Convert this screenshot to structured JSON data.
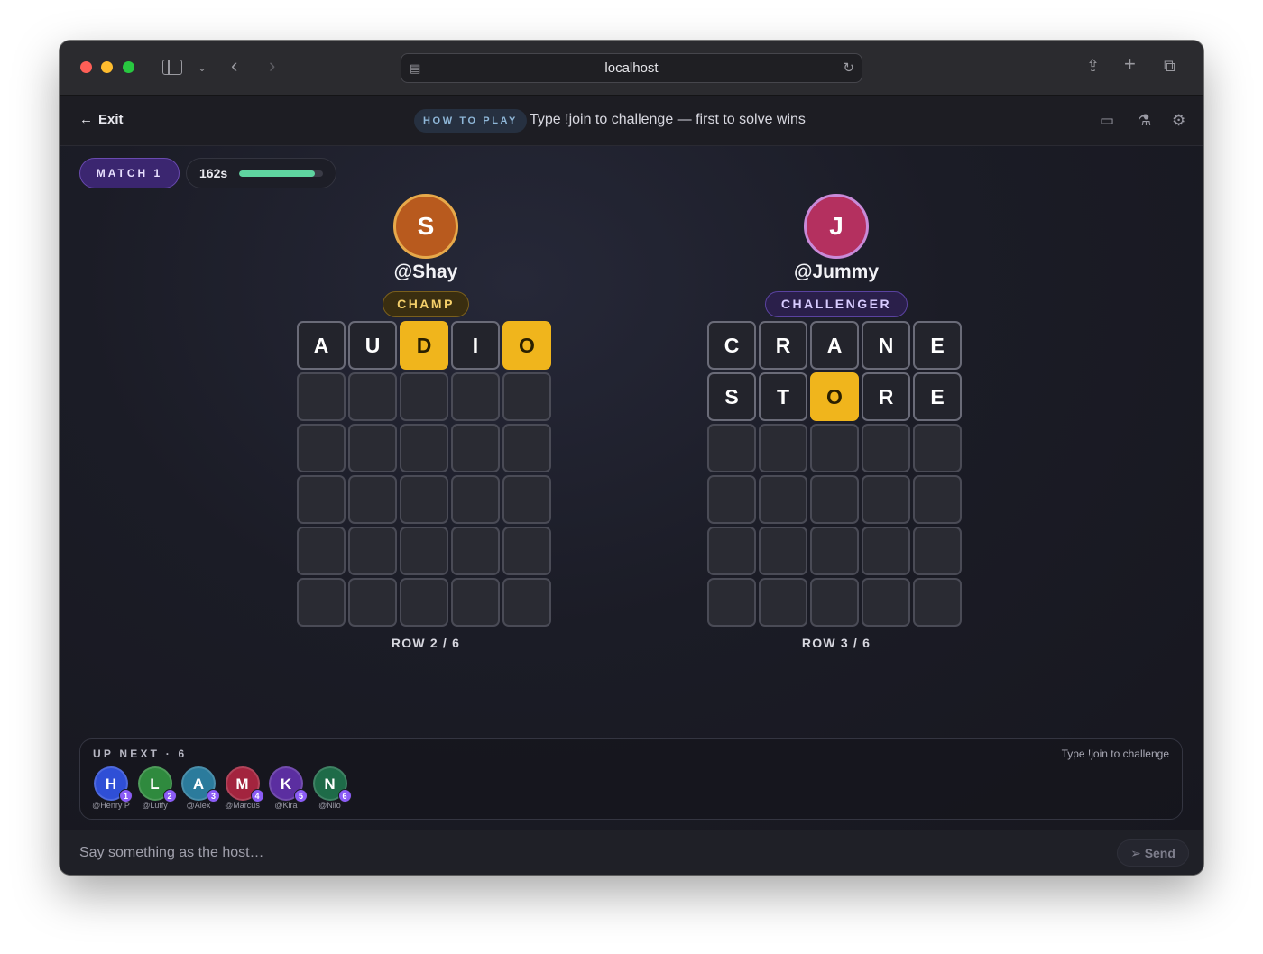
{
  "browser": {
    "url": "localhost"
  },
  "header": {
    "exit_label": "Exit",
    "howto_label": "HOW TO PLAY",
    "howto_text": "Type !join to challenge — first to solve wins"
  },
  "match": {
    "label": "MATCH 1",
    "timer": "162s",
    "timer_progress": 0.9
  },
  "players": [
    {
      "initial": "S",
      "handle": "@Shay",
      "role": "CHAMP",
      "avatar_color": "#b85a1e",
      "avatar_ring": "#e7a94a",
      "rows": [
        [
          "A",
          "U",
          "D",
          "I",
          "O"
        ],
        [
          "",
          "",
          "",
          "",
          ""
        ],
        [
          "",
          "",
          "",
          "",
          ""
        ],
        [
          "",
          "",
          "",
          "",
          ""
        ],
        [
          "",
          "",
          "",
          "",
          ""
        ],
        [
          "",
          "",
          "",
          "",
          ""
        ]
      ],
      "states": [
        [
          "absent",
          "absent",
          "present",
          "absent",
          "present"
        ],
        [],
        [],
        [],
        [],
        []
      ],
      "row_label": "ROW 2 / 6"
    },
    {
      "initial": "J",
      "handle": "@Jummy",
      "role": "CHALLENGER",
      "avatar_color": "#b4305f",
      "avatar_ring": "#c98ad8",
      "rows": [
        [
          "C",
          "R",
          "A",
          "N",
          "E"
        ],
        [
          "S",
          "T",
          "O",
          "R",
          "E"
        ],
        [
          "",
          "",
          "",
          "",
          ""
        ],
        [
          "",
          "",
          "",
          "",
          ""
        ],
        [
          "",
          "",
          "",
          "",
          ""
        ],
        [
          "",
          "",
          "",
          "",
          ""
        ]
      ],
      "states": [
        [
          "absent",
          "absent",
          "absent",
          "absent",
          "absent"
        ],
        [
          "absent",
          "absent",
          "present",
          "absent",
          "absent"
        ],
        [],
        [],
        [],
        []
      ],
      "row_label": "ROW 3 / 6"
    }
  ],
  "up_next": {
    "title": "UP NEXT · 6",
    "hint": "Type !join to challenge",
    "queue": [
      {
        "initial": "H",
        "name": "@Henry P",
        "position": "1",
        "color": "#2f4fd6"
      },
      {
        "initial": "L",
        "name": "@Luffy",
        "position": "2",
        "color": "#2f8a3e"
      },
      {
        "initial": "A",
        "name": "@Alex",
        "position": "3",
        "color": "#2b7b9c"
      },
      {
        "initial": "M",
        "name": "@Marcus",
        "position": "4",
        "color": "#a3243e"
      },
      {
        "initial": "K",
        "name": "@Kira",
        "position": "5",
        "color": "#5b2ea0"
      },
      {
        "initial": "N",
        "name": "@Nilo",
        "position": "6",
        "color": "#1e6b48"
      }
    ]
  },
  "chat": {
    "placeholder": "Say something as the host…",
    "send_label": "Send"
  }
}
